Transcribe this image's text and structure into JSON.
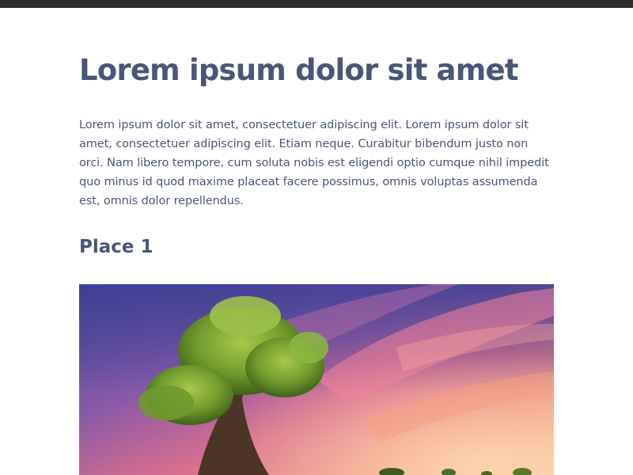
{
  "article": {
    "title": "Lorem ipsum dolor sit amet",
    "intro": "Lorem ipsum dolor sit amet, consectetuer adipiscing elit. Lorem ipsum dolor sit amet, consectetuer adipiscing elit. Etiam neque. Curabitur bibendum justo non orci. Nam libero tempore, cum soluta nobis est eligendi optio cumque nihil impedit quo minus id quod maxime placeat facere possimus, omnis voluptas assumenda est, omnis dolor repellendus.",
    "sections": [
      {
        "heading": "Place 1"
      }
    ]
  },
  "colors": {
    "topbar": "#2d2d2d",
    "heading_text": "#4a5677",
    "body_text": "#4a5677",
    "background": "#ffffff"
  }
}
